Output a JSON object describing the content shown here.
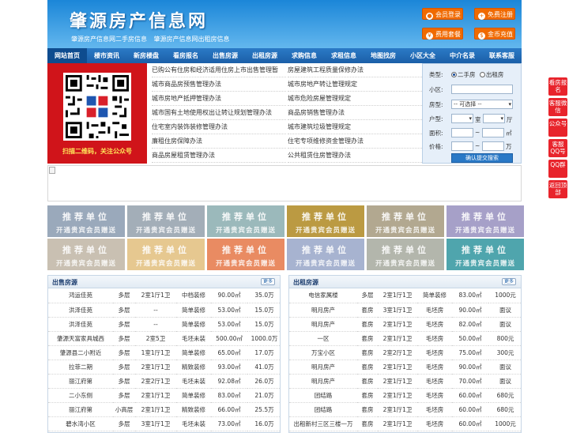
{
  "header": {
    "title": "肇源房产信息网",
    "subtitle": "肇源房产信息网二手房信息   肇源房产信息网出租房信息",
    "buttons": [
      {
        "label": "会员登录",
        "icon": "user-icon"
      },
      {
        "label": "免费注册",
        "icon": "user-add-icon"
      },
      {
        "label": "费用套餐",
        "icon": "money-icon"
      },
      {
        "label": "金币充值",
        "icon": "coin-icon"
      }
    ]
  },
  "nav": [
    "网站首页",
    "楼市资讯",
    "新房楼盘",
    "看房报名",
    "出售房源",
    "出租房源",
    "求购信息",
    "求租信息",
    "地图找房",
    "小区大全",
    "中介名录",
    "联系客服"
  ],
  "qr": {
    "caption": "扫描二维码，关注公众号"
  },
  "news_left": [
    "已购公有住房和经济适用住房上市出售管理暂",
    "城市商品房预售管理办法",
    "城市房地产抵押管理办法",
    "城市国有土地使用权出让转让规划管理办法",
    "住宅室内装饰装修管理办法",
    "廉租住房保障办法",
    "商品房屋租赁管理办法"
  ],
  "news_right": [
    "房屋建筑工程质量保修办法",
    "城市房地产转让管理规定",
    "城市危险房屋管理规定",
    "商品房销售管理办法",
    "城市建筑垃圾管理规定",
    "住宅专项维修资金管理办法",
    "公共租赁住房管理办法"
  ],
  "search": {
    "type_label": "类型:",
    "type_options": [
      "二手房",
      "出租房"
    ],
    "community_label": "小区:",
    "house_label": "房型:",
    "house_select": "-- 可选择 --",
    "layout_label": "户型:",
    "layout_unit1": "室",
    "layout_unit2": "厅",
    "area_label": "面积:",
    "area_sep": "~",
    "area_unit": "㎡",
    "price_label": "价格:",
    "price_sep": "~",
    "price_unit": "万",
    "submit": "确认提交搜索"
  },
  "ads": {
    "line1": "推荐单位",
    "line2": "开通贵宾会员赠送",
    "colors": [
      "#9aa9bb",
      "#a3aeb8",
      "#9bb9bb",
      "#bb9a42",
      "#b2a890",
      "#a6a0c8",
      "#c9c0b2",
      "#e6c890",
      "#e98b62",
      "#a7b3d0",
      "#b3b6ac",
      "#4fa5ad"
    ]
  },
  "sale": {
    "title": "出售房源",
    "more": "更多",
    "rows": [
      [
        "鸿运佳苑",
        "多层",
        "2室1厅1卫",
        "中档装修",
        "90.00㎡",
        "35.0万"
      ],
      [
        "洪泽佳苑",
        "多层",
        "--",
        "简单装修",
        "53.00㎡",
        "15.0万"
      ],
      [
        "洪泽佳苑",
        "多层",
        "--",
        "简单装修",
        "53.00㎡",
        "15.0万"
      ],
      [
        "肇源天富家具城西",
        "多层",
        "2室5卫",
        "毛坯未装",
        "500.00㎡",
        "1000.0万"
      ],
      [
        "肇源县二小附近",
        "多层",
        "1室1厅1卫",
        "简单装修",
        "65.00㎡",
        "17.0万"
      ],
      [
        "拉菲二期",
        "多层",
        "2室1厅1卫",
        "精致装修",
        "93.00㎡",
        "41.0万"
      ],
      [
        "丽江府第",
        "多层",
        "2室2厅1卫",
        "毛坯未装",
        "92.08㎡",
        "26.0万"
      ],
      [
        "二小东侧",
        "多层",
        "2室1厅1卫",
        "简单装修",
        "83.00㎡",
        "21.0万"
      ],
      [
        "丽江府第",
        "小高层",
        "2室1厅1卫",
        "精致装修",
        "66.00㎡",
        "25.5万"
      ],
      [
        "碧水湾小区",
        "多层",
        "3室1厅1卫",
        "毛坯未装",
        "73.00㎡",
        "16.0万"
      ]
    ]
  },
  "rent": {
    "title": "出租房源",
    "more": "更多",
    "rows": [
      [
        "电信家属楼",
        "多层",
        "2室1厅1卫",
        "简单装修",
        "83.00㎡",
        "1000元"
      ],
      [
        "明月房产",
        "套房",
        "3室1厅1卫",
        "毛坯房",
        "90.00㎡",
        "面议"
      ],
      [
        "明月房产",
        "套房",
        "2室1厅1卫",
        "毛坯房",
        "82.00㎡",
        "面议"
      ],
      [
        "一区",
        "套房",
        "2室1厅1卫",
        "毛坯房",
        "50.00㎡",
        "800元"
      ],
      [
        "万宝小区",
        "套房",
        "2室2厅1卫",
        "毛坯房",
        "75.00㎡",
        "300元"
      ],
      [
        "明月房产",
        "套房",
        "2室1厅1卫",
        "毛坯房",
        "90.00㎡",
        "面议"
      ],
      [
        "明月房产",
        "套房",
        "2室1厅1卫",
        "毛坯房",
        "70.00㎡",
        "面议"
      ],
      [
        "团结路",
        "套房",
        "2室1厅1卫",
        "毛坯房",
        "60.00㎡",
        "680元"
      ],
      [
        "团结路",
        "套房",
        "2室1厅1卫",
        "毛坯房",
        "60.00㎡",
        "680元"
      ],
      [
        "出租新村三区三楼一万",
        "套房",
        "2室1厅1卫",
        "毛坯房",
        "60.00㎡",
        "1000元"
      ]
    ]
  },
  "floats": [
    "看房报名",
    "客服微信",
    "公众号",
    "客服QQ号",
    "QQ群",
    "返回顶部"
  ]
}
